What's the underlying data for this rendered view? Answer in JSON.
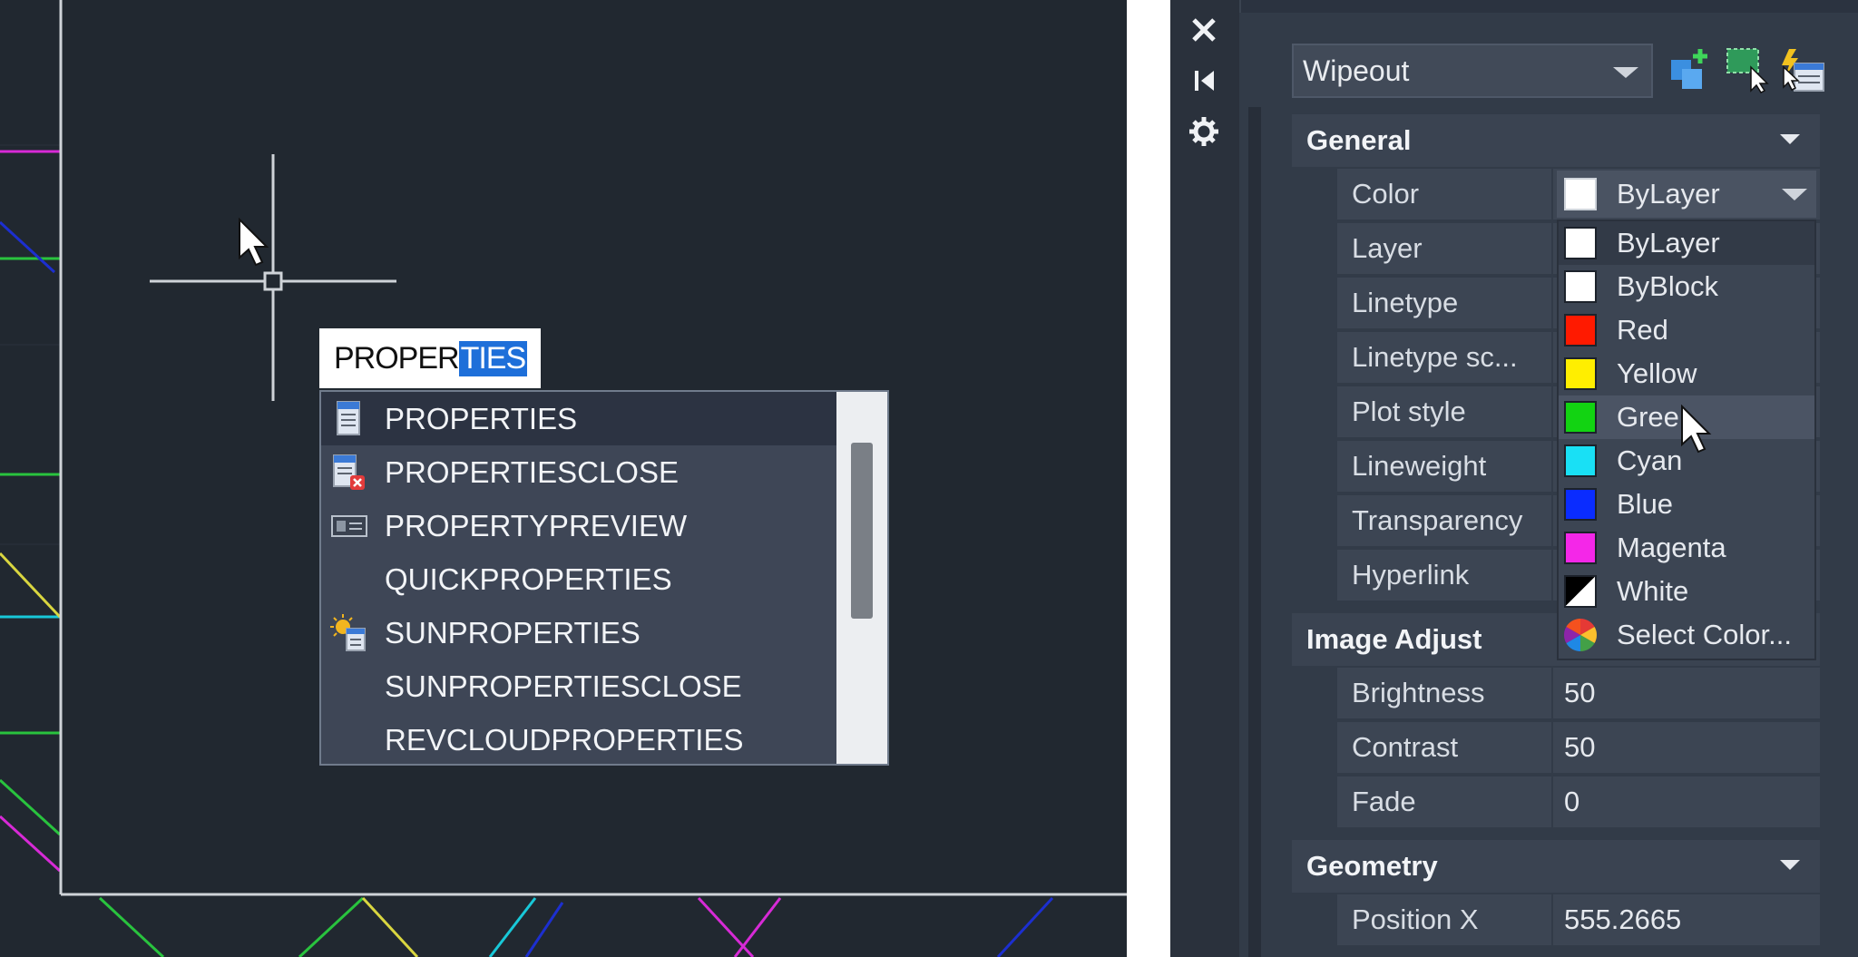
{
  "command_line": {
    "typed": "PROPER",
    "autocomplete_selected": "TIES"
  },
  "autocomplete": {
    "items": [
      {
        "label": "PROPERTIES",
        "icon": "properties-icon",
        "selected": true
      },
      {
        "label": "PROPERTIESCLOSE",
        "icon": "properties-close-icon",
        "selected": false
      },
      {
        "label": "PROPERTYPREVIEW",
        "icon": "property-preview-icon",
        "selected": false
      },
      {
        "label": "QUICKPROPERTIES",
        "icon": "",
        "selected": false
      },
      {
        "label": "SUNPROPERTIES",
        "icon": "sun-properties-icon",
        "selected": false
      },
      {
        "label": "SUNPROPERTIESCLOSE",
        "icon": "",
        "selected": false
      },
      {
        "label": "REVCLOUDPROPERTIES",
        "icon": "",
        "selected": false
      }
    ]
  },
  "palette": {
    "titlebar_icons": [
      "close-icon",
      "auto-hide-icon",
      "settings-icon"
    ],
    "object_type": "Wipeout",
    "tool_icons": [
      "toggle-pickadd-icon",
      "select-objects-icon",
      "quick-select-icon"
    ],
    "sections": {
      "general": {
        "title": "General",
        "properties": [
          {
            "name": "Color",
            "value": ""
          },
          {
            "name": "Layer",
            "value": ""
          },
          {
            "name": "Linetype",
            "value": ""
          },
          {
            "name": "Linetype sc...",
            "value": ""
          },
          {
            "name": "Plot style",
            "value": ""
          },
          {
            "name": "Lineweight",
            "value": ""
          },
          {
            "name": "Transparency",
            "value": ""
          },
          {
            "name": "Hyperlink",
            "value": ""
          }
        ]
      },
      "image_adjust": {
        "title": "Image Adjust",
        "properties": [
          {
            "name": "Brightness",
            "value": "50"
          },
          {
            "name": "Contrast",
            "value": "50"
          },
          {
            "name": "Fade",
            "value": "0"
          }
        ]
      },
      "geometry": {
        "title": "Geometry",
        "properties": [
          {
            "name": "Position X",
            "value": "555.2665"
          }
        ]
      }
    },
    "color_field": {
      "value": "ByLayer"
    },
    "color_options": [
      {
        "label": "ByLayer",
        "swatch": "#ffffff"
      },
      {
        "label": "ByBlock",
        "swatch": "#ffffff"
      },
      {
        "label": "Red",
        "swatch": "#ff1a00"
      },
      {
        "label": "Yellow",
        "swatch": "#ffee00"
      },
      {
        "label": "Gree",
        "swatch": "#12d312"
      },
      {
        "label": "Cyan",
        "swatch": "#19e0f5"
      },
      {
        "label": "Blue",
        "swatch": "#0a2cff"
      },
      {
        "label": "Magenta",
        "swatch": "#f427e8"
      },
      {
        "label": "White",
        "swatch": "split-black-white"
      },
      {
        "label": "Select Color...",
        "swatch": "color-wheel"
      }
    ]
  },
  "colors": {
    "canvas_bg": "#212830",
    "palette_bg": "#323b48",
    "accent_selection": "#1e6fd9"
  }
}
